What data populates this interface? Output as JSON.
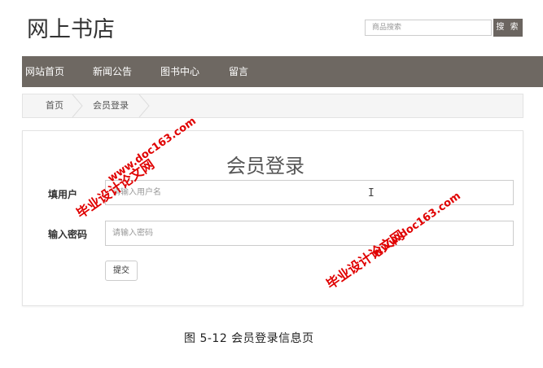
{
  "header": {
    "logo": "网上书店",
    "search_placeholder": "商品搜索",
    "search_button": "搜 索"
  },
  "nav": {
    "items": [
      "网站首页",
      "新闻公告",
      "图书中心",
      "留言"
    ]
  },
  "breadcrumb": {
    "items": [
      "首页",
      "会员登录"
    ]
  },
  "form": {
    "title": "会员登录",
    "username_label": "填用户",
    "username_placeholder": "请输入用户名",
    "password_label": "输入密码",
    "password_placeholder": "请输入密码",
    "submit_label": "提交"
  },
  "watermarks": {
    "site": "www.doc163.com",
    "cn": "毕业设计论文网"
  },
  "caption": "图 5-12 会员登录信息页",
  "colors": {
    "nav_bg": "#6e6862",
    "search_button_bg": "#6b6560",
    "watermark": "#e00000"
  }
}
